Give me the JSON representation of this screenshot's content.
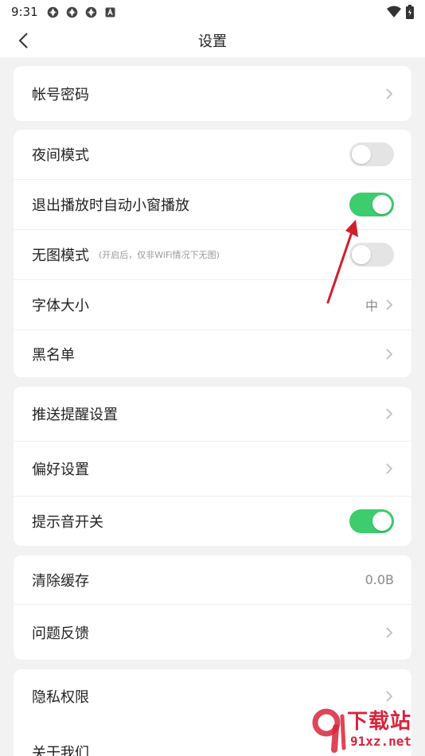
{
  "status_bar": {
    "time": "9:31",
    "notification_icons": [
      "app-notification-icon",
      "app-notification-icon",
      "app-notification-icon",
      "a-notification-icon"
    ],
    "right_icons": [
      "wifi-icon",
      "battery-icon"
    ]
  },
  "header": {
    "title": "设置",
    "back_icon": "back-arrow-icon"
  },
  "cards": {
    "account": {
      "account_password": "帐号密码"
    },
    "display": {
      "night_mode": {
        "label": "夜间模式",
        "enabled": false
      },
      "auto_mini_window": {
        "label": "退出播放时自动小窗播放",
        "enabled": true
      },
      "no_image_mode": {
        "label": "无图模式",
        "hint": "(开启后，仅非WiFi情况下无图)",
        "enabled": false
      },
      "font_size": {
        "label": "字体大小",
        "value": "中"
      },
      "blacklist": {
        "label": "黑名单"
      }
    },
    "notifications": {
      "push_settings": "推送提醒设置",
      "preferences": "偏好设置",
      "sound_toggle": {
        "label": "提示音开关",
        "enabled": true
      }
    },
    "storage": {
      "clear_cache": {
        "label": "清除缓存",
        "value": "0.0B"
      },
      "feedback": "问题反馈"
    },
    "about": {
      "privacy": "隐私权限",
      "about_us": "关于我们"
    }
  },
  "watermark": {
    "brand": "下载站",
    "domain": "91xz.net"
  },
  "colors": {
    "toggle_on": "#3dcc6e",
    "toggle_off": "#e4e4e4",
    "annotation_arrow": "#d21f2c",
    "watermark": "#d8253b"
  }
}
